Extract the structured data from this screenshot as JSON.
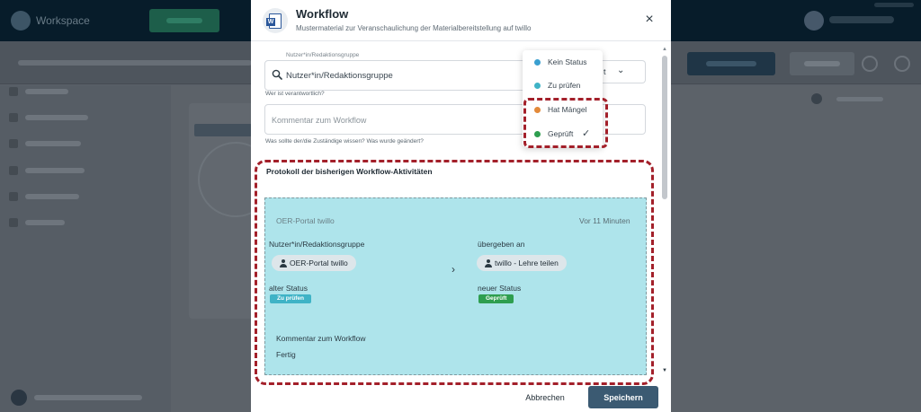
{
  "background": {
    "workspace_label": "Workspace"
  },
  "modal": {
    "title": "Workflow",
    "subtitle": "Mustermaterial zur Veranschaulichung der Materialbereitstellung auf twillo",
    "close_icon": "×",
    "user_field": {
      "label": "Nutzer*in/Redaktionsgruppe",
      "placeholder": "Nutzer*in/Redaktionsgruppe",
      "helper": "Wer ist verantwortlich?"
    },
    "comment_field": {
      "placeholder": "Kommentar zum Workflow",
      "helper": "Was sollte der/die Zuständige wissen? Was wurde geändert?"
    },
    "status_select": {
      "value_fragment": "t",
      "chevron": "⌄"
    },
    "status_dropdown": {
      "items": [
        {
          "label": "Kein Status",
          "color": "#3a9fd0"
        },
        {
          "label": "Zu prüfen",
          "color": "#3fb3c6"
        },
        {
          "label": "Hat Mängel",
          "color": "#e38a3a"
        },
        {
          "label": "Geprüft",
          "color": "#2e9e4f",
          "selected": true
        }
      ],
      "check": "✓"
    },
    "protocol": {
      "title": "Protokoll der bisherigen Workflow-Aktivitäten",
      "activity": {
        "source": "OER-Portal twillo",
        "time": "Vor 11 Minuten",
        "from_label": "Nutzer*in/Redaktionsgruppe",
        "from_chip": "OER-Portal twillo",
        "to_label": "übergeben an",
        "to_chip": "twillo - Lehre teilen",
        "arrow": "›",
        "old_status_label": "alter Status",
        "old_status": "Zu prüfen",
        "old_status_color": "#3fb3c6",
        "new_status_label": "neuer Status",
        "new_status": "Geprüft",
        "new_status_color": "#2e9e4f",
        "comment_label": "Kommentar zum Workflow",
        "comment": "Fertig"
      }
    },
    "buttons": {
      "cancel": "Abbrechen",
      "save": "Speichern"
    }
  }
}
